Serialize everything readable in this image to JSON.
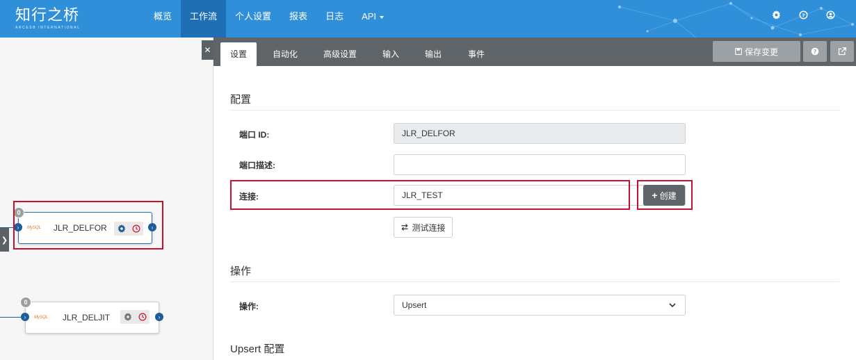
{
  "app": {
    "logo_text": "知行之桥",
    "logo_subtext": "ARCESB INTERNATIONAL"
  },
  "nav": {
    "items": [
      {
        "label": "概览",
        "active": false
      },
      {
        "label": "工作流",
        "active": true
      },
      {
        "label": "个人设置",
        "active": false
      },
      {
        "label": "报表",
        "active": false
      },
      {
        "label": "日志",
        "active": false
      },
      {
        "label": "API",
        "active": false,
        "dropdown": true
      }
    ],
    "icons": [
      "gear-icon",
      "help-icon",
      "user-icon"
    ]
  },
  "canvas": {
    "nodes": [
      {
        "label": "JLR_DELFOR",
        "badge": "0",
        "selected": true,
        "logo": "MySQL"
      },
      {
        "label": "JLR_DELJIT",
        "badge": "0",
        "selected": false,
        "logo": "MySQL"
      }
    ]
  },
  "tabs": [
    {
      "label": "设置",
      "active": true
    },
    {
      "label": "自动化",
      "active": false
    },
    {
      "label": "高级设置",
      "active": false
    },
    {
      "label": "输入",
      "active": false
    },
    {
      "label": "输出",
      "active": false
    },
    {
      "label": "事件",
      "active": false
    }
  ],
  "toolbar": {
    "save_label": "保存变更"
  },
  "config": {
    "section_title": "配置",
    "port_id_label": "端口 ID:",
    "port_id_value": "JLR_DELFOR",
    "port_desc_label": "端口描述:",
    "port_desc_value": "",
    "connection_label": "连接:",
    "connection_value": "JLR_TEST",
    "create_label": "创建",
    "test_label": "测试连接"
  },
  "operation": {
    "section_title": "操作",
    "label": "操作:",
    "value": "Upsert"
  },
  "upsert": {
    "section_title": "Upsert 配置"
  },
  "colors": {
    "header": "#2f8fd8",
    "header_active": "#1e6fb3",
    "tab_bar": "#5e6468",
    "highlight": "#c8102e",
    "port": "#1f5c99"
  }
}
